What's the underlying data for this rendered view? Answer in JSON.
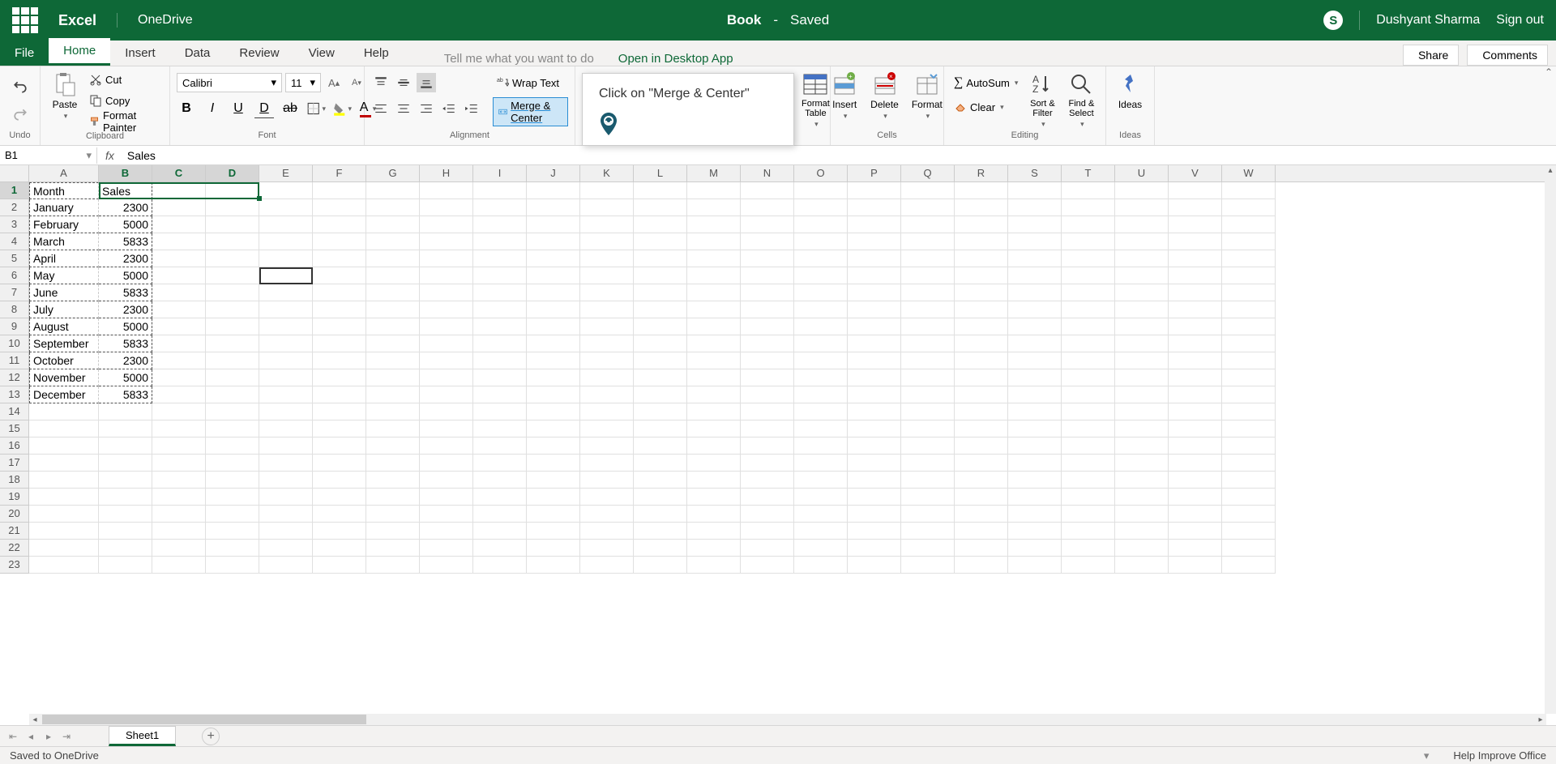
{
  "title_bar": {
    "app": "Excel",
    "location": "OneDrive",
    "doc_name": "Book",
    "dash": "-",
    "save_state": "Saved",
    "user_name": "Dushyant Sharma",
    "signout": "Sign out"
  },
  "tabs": {
    "file": "File",
    "home": "Home",
    "insert": "Insert",
    "data": "Data",
    "review": "Review",
    "view": "View",
    "help": "Help",
    "search_placeholder": "Tell me what you want to do",
    "open_desktop": "Open in Desktop App",
    "share": "Share",
    "comments": "Comments"
  },
  "ribbon": {
    "undo_group": "Undo",
    "clipboard_group": "Clipboard",
    "paste": "Paste",
    "cut": "Cut",
    "copy": "Copy",
    "format_painter": "Format Painter",
    "font_group": "Font",
    "font_name": "Calibri",
    "font_size": "11",
    "alignment_group": "Alignment",
    "wrap_text": "Wrap Text",
    "merge_center": "Merge & Center",
    "tables_group": "",
    "format_table": "Format Table",
    "cells_group": "Cells",
    "insert": "Insert",
    "delete": "Delete",
    "format": "Format",
    "editing_group": "Editing",
    "autosum": "AutoSum",
    "clear": "Clear",
    "sort_filter": "Sort & Filter",
    "find_select": "Find & Select",
    "ideas_group": "Ideas",
    "ideas": "Ideas"
  },
  "callout": {
    "text": "Click on \"Merge & Center\""
  },
  "formula_bar": {
    "name_box": "B1",
    "formula": "Sales"
  },
  "columns": [
    "A",
    "B",
    "C",
    "D",
    "E",
    "F",
    "G",
    "H",
    "I",
    "J",
    "K",
    "L",
    "M",
    "N",
    "O",
    "P",
    "Q",
    "R",
    "S",
    "T",
    "U",
    "V",
    "W"
  ],
  "col_widths": {
    "A": 86,
    "default": 66
  },
  "row_count": 23,
  "selected_cols": [
    "B",
    "C",
    "D"
  ],
  "selected_row": 1,
  "active_cell": "E6",
  "cells": {
    "A1": {
      "v": "Month",
      "t": "s"
    },
    "B1": {
      "v": "Sales",
      "t": "s"
    },
    "A2": {
      "v": "January",
      "t": "s"
    },
    "B2": {
      "v": "2300",
      "t": "n"
    },
    "A3": {
      "v": "February",
      "t": "s"
    },
    "B3": {
      "v": "5000",
      "t": "n"
    },
    "A4": {
      "v": "March",
      "t": "s"
    },
    "B4": {
      "v": "5833",
      "t": "n"
    },
    "A5": {
      "v": "April",
      "t": "s"
    },
    "B5": {
      "v": "2300",
      "t": "n"
    },
    "A6": {
      "v": "May",
      "t": "s"
    },
    "B6": {
      "v": "5000",
      "t": "n"
    },
    "A7": {
      "v": "June",
      "t": "s"
    },
    "B7": {
      "v": "5833",
      "t": "n"
    },
    "A8": {
      "v": "July",
      "t": "s"
    },
    "B8": {
      "v": "2300",
      "t": "n"
    },
    "A9": {
      "v": "August",
      "t": "s"
    },
    "B9": {
      "v": "5000",
      "t": "n"
    },
    "A10": {
      "v": "September",
      "t": "s"
    },
    "B10": {
      "v": "5833",
      "t": "n"
    },
    "A11": {
      "v": "October",
      "t": "s"
    },
    "B11": {
      "v": "2300",
      "t": "n"
    },
    "A12": {
      "v": "November",
      "t": "s"
    },
    "B12": {
      "v": "5000",
      "t": "n"
    },
    "A13": {
      "v": "December",
      "t": "s"
    },
    "B13": {
      "v": "5833",
      "t": "n"
    }
  },
  "marching_ants_range": {
    "start": "A1",
    "end": "B13"
  },
  "sheet": {
    "name": "Sheet1"
  },
  "status": {
    "left": "Saved to OneDrive",
    "help": "Help Improve Office"
  }
}
